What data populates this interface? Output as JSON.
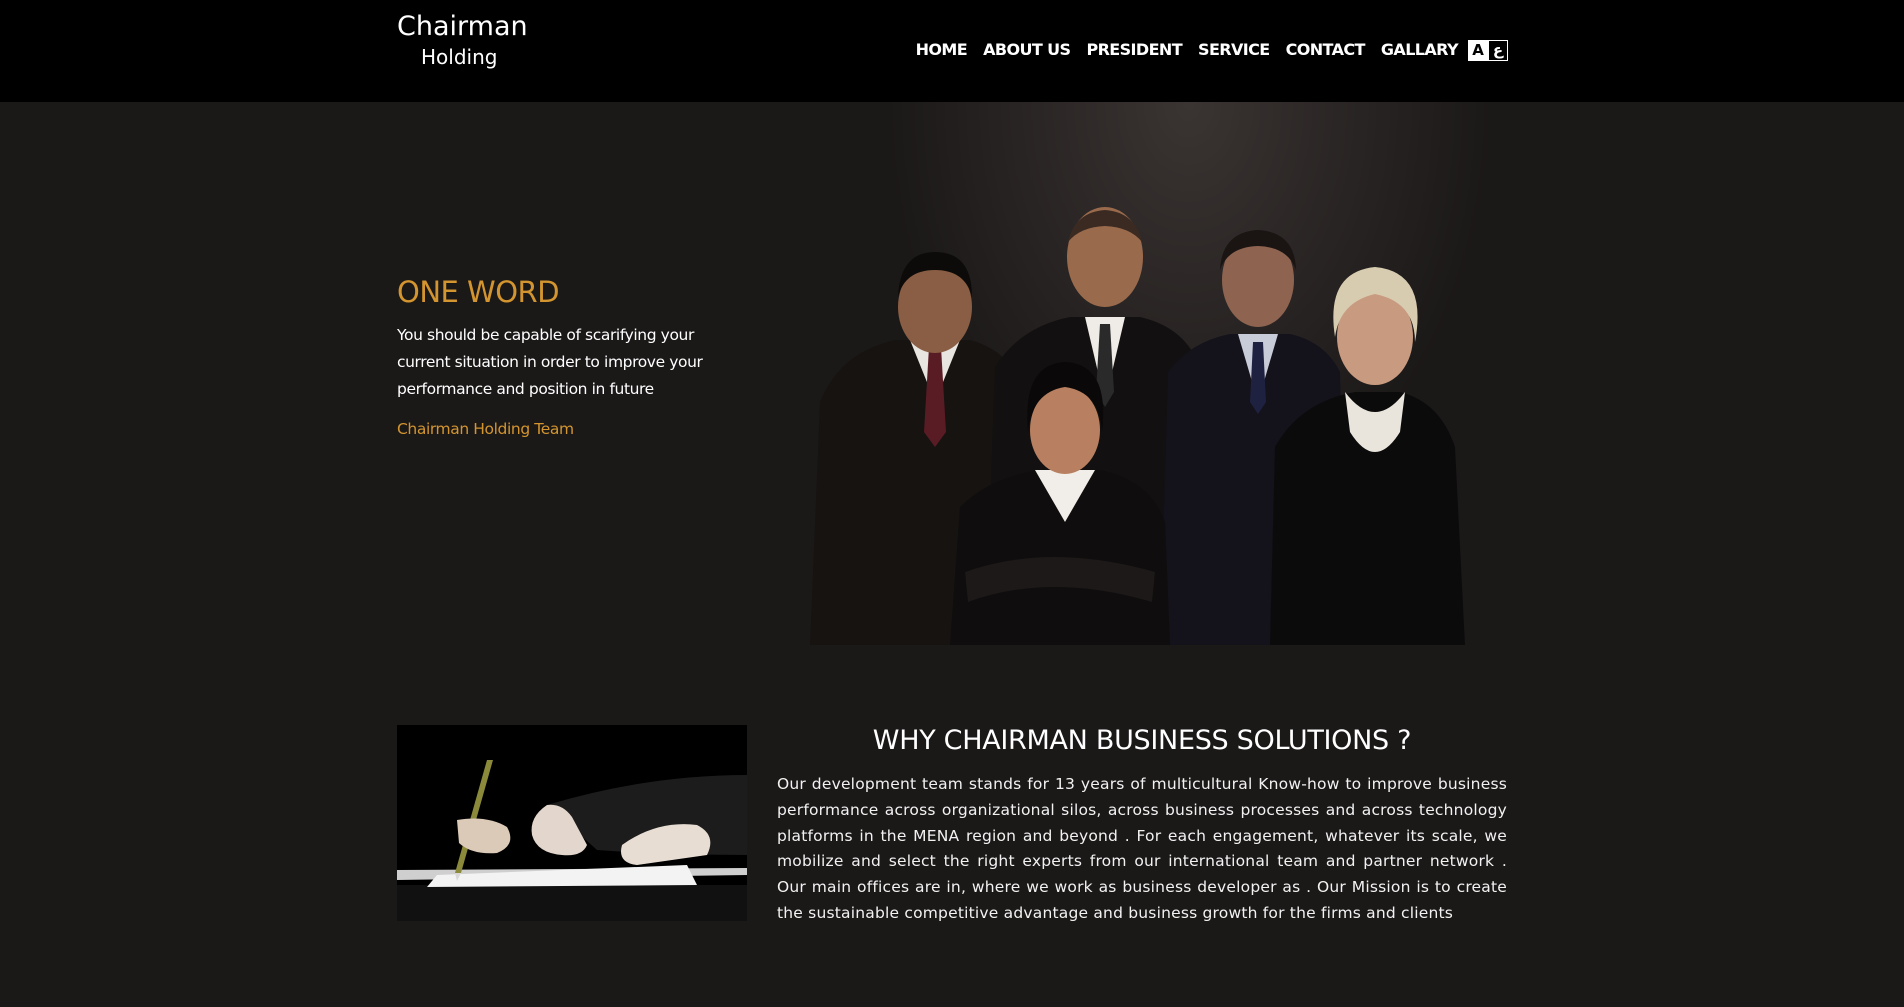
{
  "header": {
    "brand_line1": "Chairman",
    "brand_line2": "Holding",
    "nav": [
      "HOME",
      "ABOUT US",
      "PRESIDENT",
      "SERVICE",
      "CONTACT",
      "GALLARY"
    ],
    "lang_en": "A",
    "lang_ar": "ع"
  },
  "hero": {
    "title": "ONE WORD",
    "body": "You should be capable of scarifying your current situation in order to improve your performance and position in future",
    "signature": "Chairman Holding Team",
    "accent_color": "#d3952f"
  },
  "why": {
    "title": "WHY CHAIRMAN BUSINESS SOLUTIONS ?",
    "body": "Our development team stands for 13 years of multicultural Know-how to improve business performance across organizational silos, across business processes and across technology platforms in the MENA region and beyond . For each engagement, whatever its scale, we mobilize and select the right experts from our international team and partner network . Our main offices are in, where we work as business developer as . Our Mission is to create the sustainable competitive advantage and business growth for the firms and clients"
  },
  "colors": {
    "page_background": "#1b1818",
    "header_background": "#000000",
    "accent": "#d3952f"
  }
}
